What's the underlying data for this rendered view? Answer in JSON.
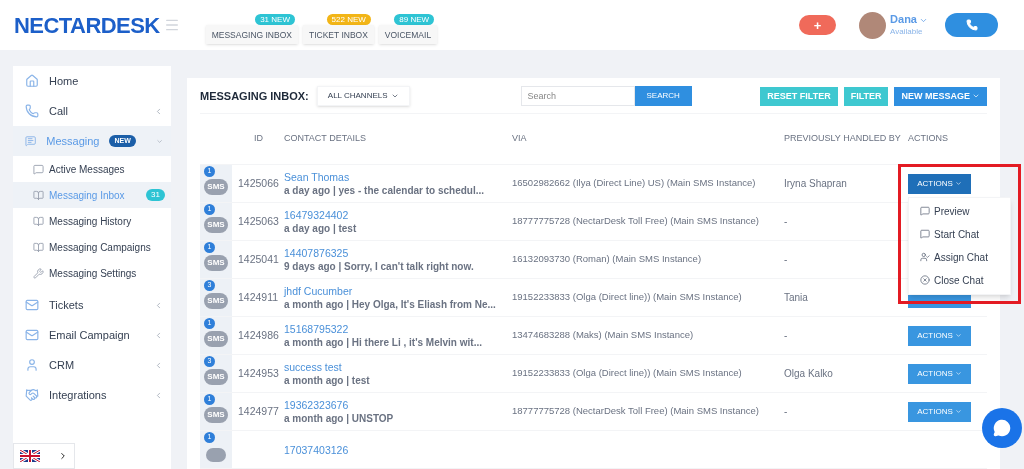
{
  "header": {
    "logo": "NECTARDESK",
    "inbox_tabs": [
      {
        "label": "MESSAGING INBOX",
        "badge": "31 NEW",
        "color": "#2ec4d4"
      },
      {
        "label": "TICKET INBOX",
        "badge": "522 NEW",
        "color": "#f2b517"
      },
      {
        "label": "VOICEMAIL",
        "badge": "89 NEW",
        "color": "#2ec4d4"
      }
    ],
    "add_button": "+",
    "user": {
      "name": "Dana",
      "status": "Available"
    }
  },
  "sidebar": {
    "items": [
      {
        "label": "Home",
        "selected": false,
        "expanded": false
      },
      {
        "label": "Call",
        "selected": false,
        "expanded": false
      },
      {
        "label": "Messaging",
        "badge": "NEW",
        "selected": true,
        "expanded": true,
        "children": [
          {
            "label": "Active Messages",
            "selected": false
          },
          {
            "label": "Messaging Inbox",
            "badge": "31",
            "selected": true
          },
          {
            "label": "Messaging History",
            "selected": false
          },
          {
            "label": "Messaging Campaigns",
            "selected": false
          },
          {
            "label": "Messaging Settings",
            "selected": false
          }
        ]
      },
      {
        "label": "Tickets",
        "selected": false,
        "expanded": false
      },
      {
        "label": "Email Campaign",
        "selected": false,
        "expanded": false
      },
      {
        "label": "CRM",
        "selected": false,
        "expanded": false
      },
      {
        "label": "Integrations",
        "selected": false,
        "expanded": false
      }
    ]
  },
  "toolbar": {
    "title": "MESSAGING INBOX:",
    "channel_select": "ALL CHANNELS",
    "search": {
      "placeholder": "Search",
      "button": "SEARCH"
    },
    "buttons": [
      "RESET FILTER",
      "FILTER"
    ],
    "new_message": "NEW MESSAGE"
  },
  "table": {
    "columns": [
      "ID",
      "CONTACT DETAILS",
      "VIA",
      "PREVIOUSLY HANDLED BY",
      "ACTIONS"
    ],
    "rows": [
      {
        "count": "1",
        "icon_label": "SMS",
        "id": "1425066",
        "name": "Sean Thomas",
        "message": "a day ago | yes - the calendar to schedul...",
        "via": "16502982662 (Ilya (Direct Line) US) (Main SMS Instance)",
        "handled_by": "Iryna Shapran",
        "action": "ACTIONS",
        "menu_open": true
      },
      {
        "count": "1",
        "icon_label": "SMS",
        "id": "1425063",
        "name": "16479324402",
        "message": "a day ago | test",
        "via": "18777775728 (NectarDesk Toll Free) (Main SMS Instance)",
        "handled_by": "-",
        "menu_open": false
      },
      {
        "count": "1",
        "icon_label": "SMS",
        "id": "1425041",
        "name": "14407876325",
        "message": "9 days ago | Sorry, I can't talk right now.",
        "via": "16132093730 (Roman) (Main SMS Instance)",
        "handled_by": "-",
        "menu_open": false
      },
      {
        "count": "3",
        "icon_label": "SMS",
        "id": "1424911",
        "name": "jhdf Cucumber",
        "message": "a month ago | Hey Olga, It's Eliash from Ne...",
        "via": "19152233833 (Olga (Direct line)) (Main SMS Instance)",
        "handled_by": "Tania",
        "menu_open": false
      },
      {
        "count": "1",
        "icon_label": "SMS",
        "id": "1424986",
        "name": "15168795322",
        "message": "a month ago | Hi there Li , it's Melvin wit...",
        "via": "13474683288 (Maks) (Main SMS Instance)",
        "handled_by": "-",
        "action": "ACTIONS",
        "menu_open": false
      },
      {
        "count": "3",
        "icon_label": "SMS",
        "id": "1424953",
        "name": "success test",
        "message": "a month ago | test",
        "via": "19152233833 (Olga (Direct line)) (Main SMS Instance)",
        "handled_by": "Olga Kalko",
        "action": "ACTIONS",
        "menu_open": false
      },
      {
        "count": "1",
        "icon_label": "SMS",
        "id": "1424977",
        "name": "19362323676",
        "message": "a month ago | UNSTOP",
        "via": "18777775728 (NectarDesk Toll Free) (Main SMS Instance)",
        "handled_by": "-",
        "action": "ACTIONS",
        "menu_open": false
      },
      {
        "count": "1",
        "name": "17037403126"
      }
    ]
  },
  "actions_menu": [
    {
      "label": "Preview",
      "kind": "preview"
    },
    {
      "label": "Start Chat",
      "kind": "chat"
    },
    {
      "label": "Assign Chat",
      "kind": "assign"
    },
    {
      "label": "Close Chat",
      "kind": "close"
    }
  ]
}
